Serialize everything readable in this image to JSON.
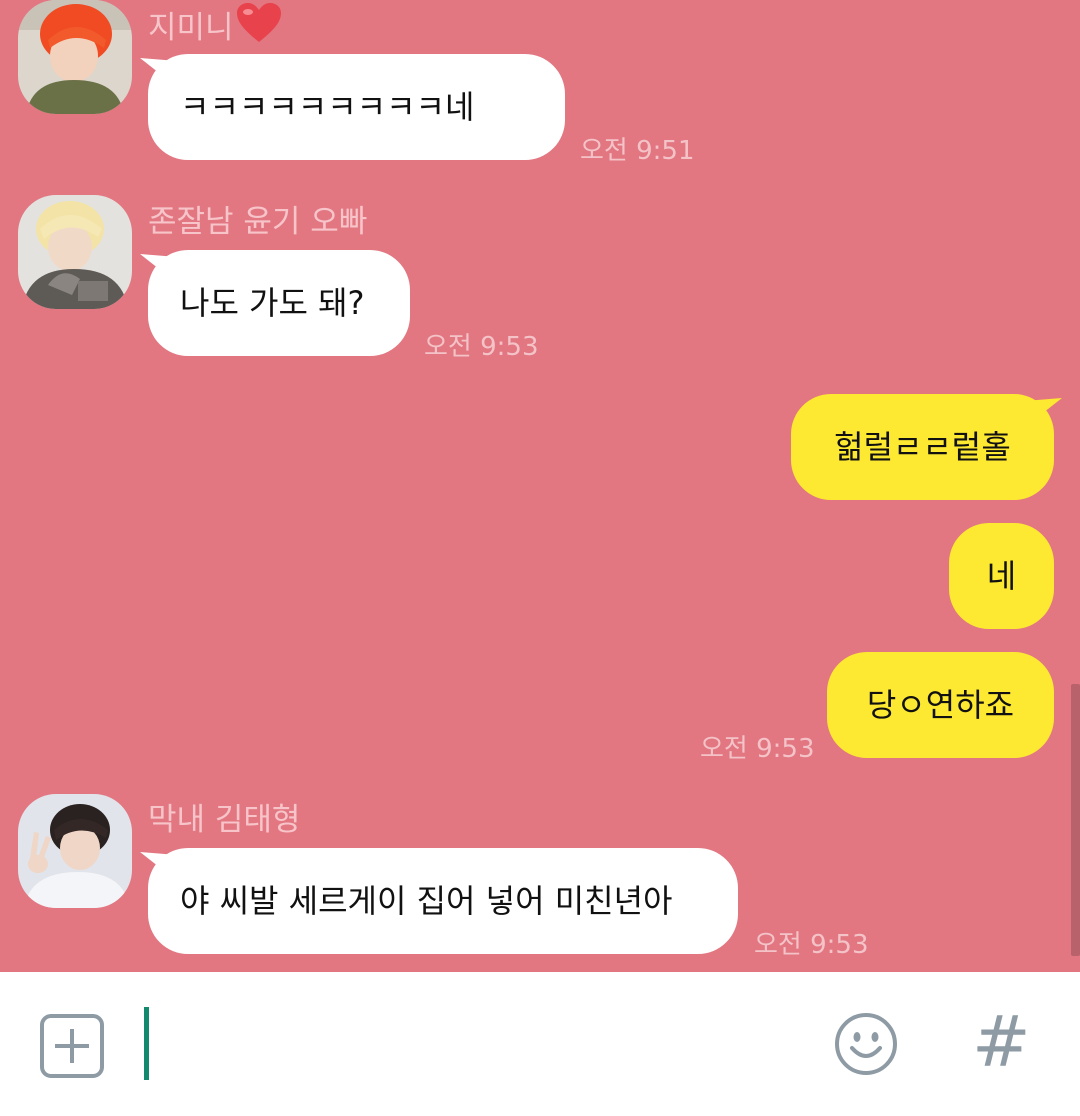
{
  "colors": {
    "chat_background": "#e27681",
    "incoming_bubble": "#ffffff",
    "outgoing_bubble": "#fee932",
    "cursor": "#138a6e",
    "icon_gray": "#8e9ba4"
  },
  "messages": [
    {
      "type": "incoming",
      "sender": "지미니",
      "sender_badge": "heart-icon",
      "text": "ㅋㅋㅋㅋㅋㅋㅋㅋㅋ네",
      "time": "오전 9:51"
    },
    {
      "type": "incoming",
      "sender": "존잘남 윤기 오빠",
      "text": "나도 가도 돼?",
      "time": "오전 9:53"
    },
    {
      "type": "outgoing",
      "texts": [
        "헒럴ㄹㄹ렅홀",
        "네",
        "당ㅇ연하죠"
      ],
      "time": "오전 9:53"
    },
    {
      "type": "incoming",
      "sender": "막내 김태형",
      "text": "야 씨발 세르게이 집어 넣어 미친년아",
      "time": "오전 9:53"
    }
  ],
  "input_bar": {
    "left_icon": "plus-icon",
    "input_value": "",
    "emoji_icon": "smiley-icon",
    "hash_label": "#"
  }
}
